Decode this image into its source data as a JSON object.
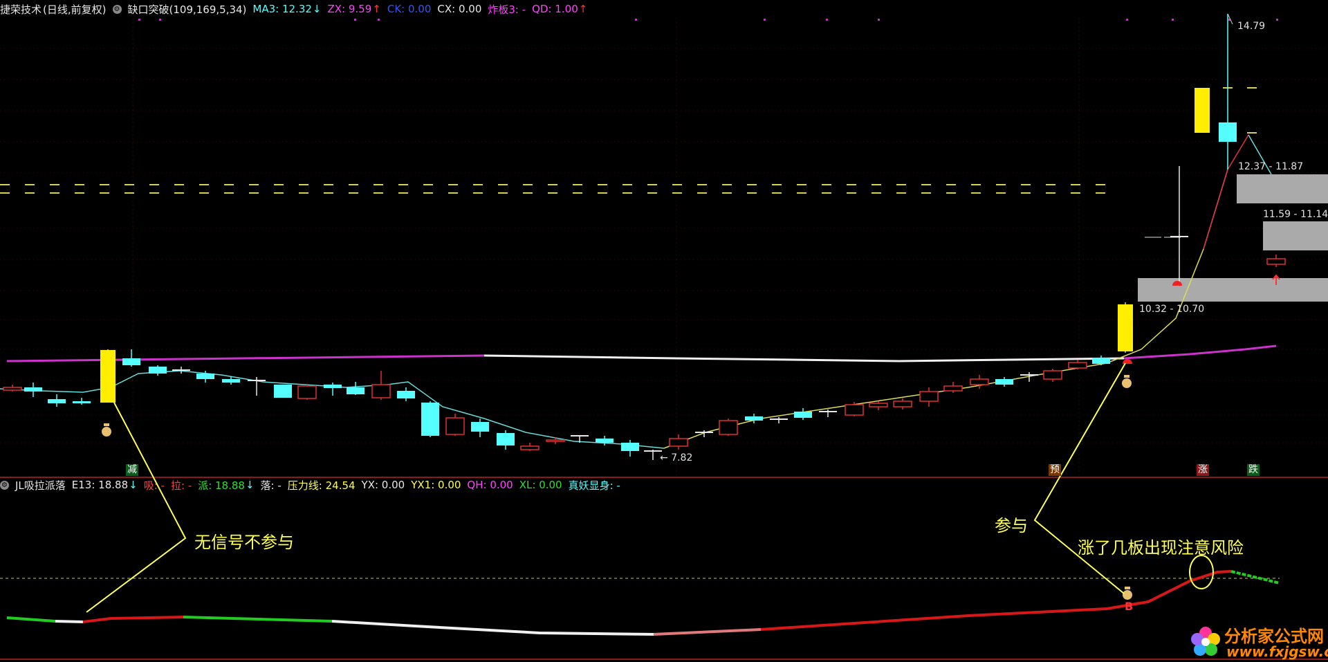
{
  "top_bar": {
    "stock_name": "捷荣技术",
    "period": "(日线,前复权)",
    "indicator": "缺口突破(109,169,5,34)",
    "ma3": "MA3: 12.32",
    "zx": "ZX: 9.59",
    "ck": "CK: 0.00",
    "cx": "CX: 0.00",
    "zhaban": "炸板3: -",
    "qd": "QD: 1.00"
  },
  "indicator_bar": {
    "name": "JL吸拉派落",
    "e13": "E13: 18.88",
    "xi": "吸: -",
    "la": "拉: -",
    "pai": "派: 18.88",
    "luo": "落: -",
    "yali": "压力线: 24.54",
    "yx": "YX: 0.00",
    "yx1": "YX1: 0.00",
    "qh": "QH: 0.00",
    "xl": "XL: 0.00",
    "zhenyao": "真妖显身: -"
  },
  "price_labels": {
    "high": "14.79",
    "low": "7.82",
    "zone1": "12.37 - 11.87",
    "zone2": "11.59 - 11.14",
    "zone3": "10.32 - 10.70"
  },
  "signals": {
    "jian": "减",
    "yu": "预",
    "zhang": "涨",
    "die": "跌",
    "b": "B"
  },
  "annotations": {
    "no_signal": "无信号不参与",
    "participate": "参与",
    "risk": "涨了几板出现注意风险"
  },
  "watermark": {
    "name": "分析家公式网",
    "url": "www.fxjgsw.com"
  },
  "colors": {
    "up": "#e03030",
    "down": "#55ffff",
    "limit_up": "#ffee00",
    "ma_line": "#66dddd",
    "pressure": "#cc33cc",
    "annotation": "#ffff55",
    "zone": "#aaaaaa"
  },
  "chart_data": {
    "type": "candlestick",
    "high": 14.79,
    "low": 7.82,
    "zones": [
      "12.37 - 11.87",
      "11.59 - 11.14",
      "10.32 - 10.70"
    ]
  }
}
